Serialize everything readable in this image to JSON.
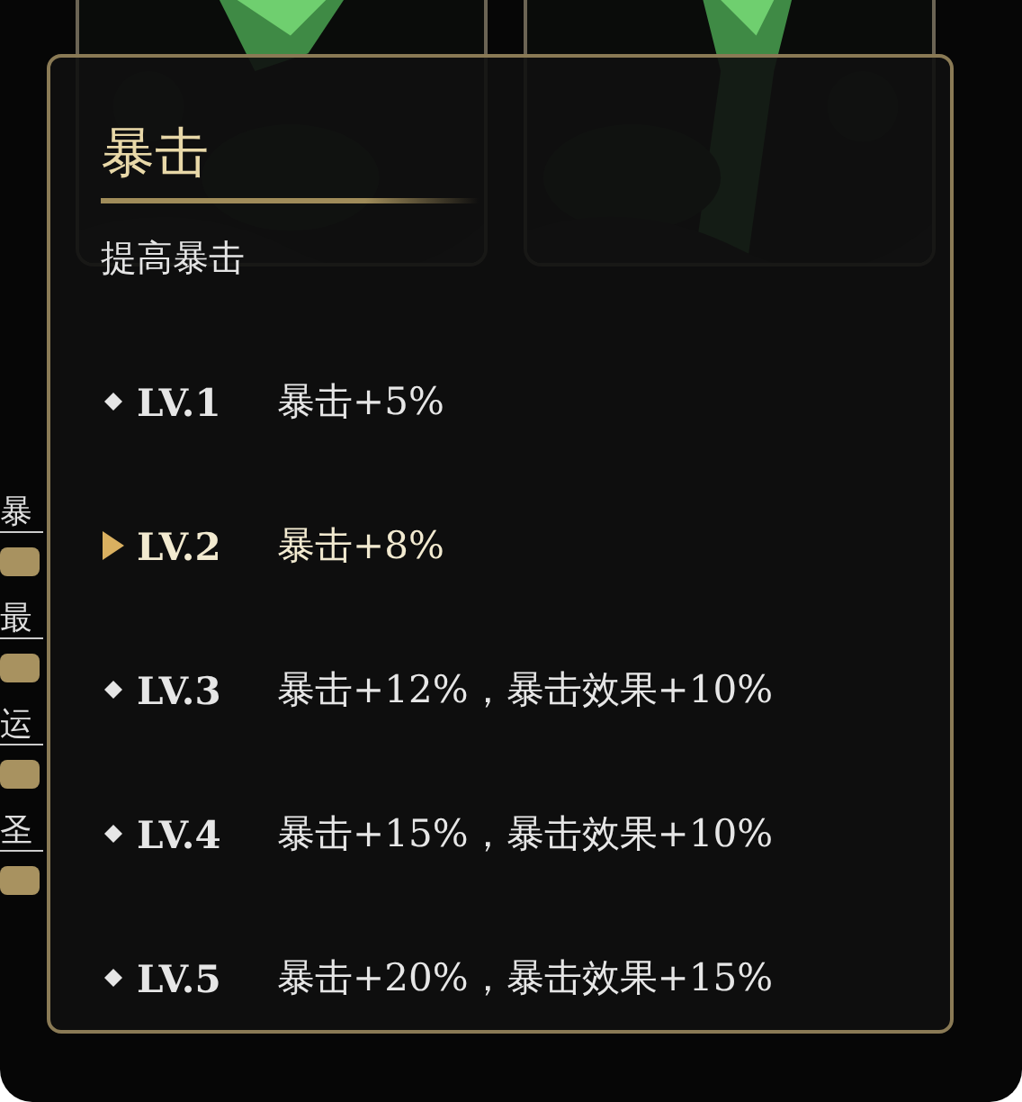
{
  "skills": [
    {
      "label": "暴"
    },
    {
      "label": "最"
    },
    {
      "label": "运"
    },
    {
      "label": "圣"
    }
  ],
  "tooltip": {
    "title": "暴击",
    "description": "提高暴击",
    "levels": [
      {
        "level": "LV.1",
        "effect": "暴击+5%",
        "selected": false
      },
      {
        "level": "LV.2",
        "effect": "暴击+8%",
        "selected": true
      },
      {
        "level": "LV.3",
        "effect": "暴击+12%，暴击效果+10%",
        "selected": false
      },
      {
        "level": "LV.4",
        "effect": "暴击+15%，暴击效果+10%",
        "selected": false
      },
      {
        "level": "LV.5",
        "effect": "暴击+20%，暴击效果+15%",
        "selected": false
      }
    ]
  }
}
